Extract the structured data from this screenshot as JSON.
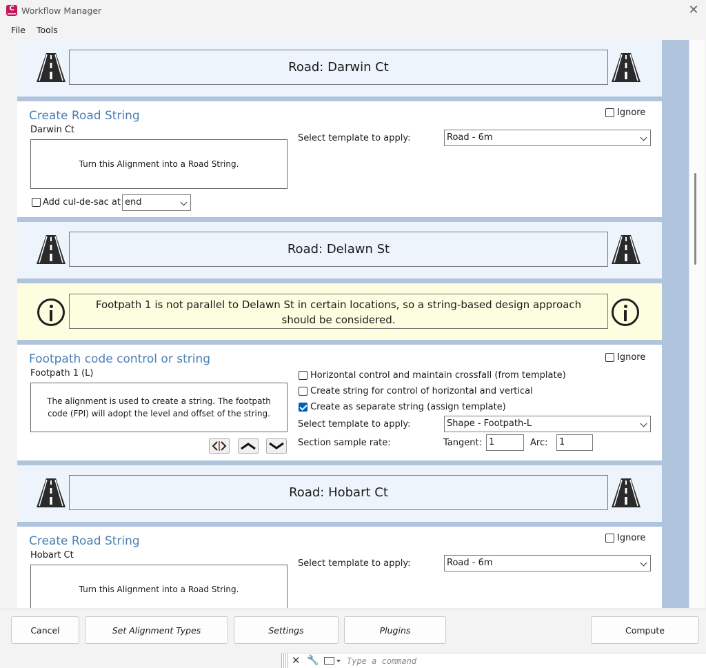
{
  "window": {
    "title": "Workflow Manager",
    "app_icon_letter": "C"
  },
  "menu": {
    "file": "File",
    "tools": "Tools"
  },
  "sections": {
    "road1": {
      "title": "Road: Darwin Ct"
    },
    "create1": {
      "title": "Create Road String",
      "subtitle": "Darwin Ct",
      "ignore_label": "Ignore",
      "ignore_checked": false,
      "description": "Turn this Alignment into a Road String.",
      "template_label": "Select template to apply:",
      "template_value": "Road - 6m",
      "culdesac_label": "Add cul-de-sac at",
      "culdesac_checked": false,
      "culdesac_value": "end"
    },
    "road2": {
      "title": "Road: Delawn St"
    },
    "warning": {
      "text": "Footpath 1 is not parallel to Delawn St in certain locations, so a string-based design approach should be considered."
    },
    "footpath": {
      "title": "Footpath code control or string",
      "subtitle": "Footpath 1 (L)",
      "ignore_label": "Ignore",
      "description": "The alignment is used to create a string. The footpath code (FPI) will adopt the level and offset of the string.",
      "option1": "Horizontal control and maintain crossfall (from template)",
      "option2": "Create string for control of horizontal and vertical",
      "option3": "Create as separate string (assign template)",
      "template_label": "Select template to apply:",
      "template_value": "Shape - Footpath-L",
      "sample_label": "Section sample rate:",
      "tangent_label": "Tangent:",
      "tangent_value": "1",
      "arc_label": "Arc:",
      "arc_value": "1"
    },
    "road3": {
      "title": "Road: Hobart Ct"
    },
    "create2": {
      "title": "Create Road String",
      "subtitle": "Hobart Ct",
      "ignore_label": "Ignore",
      "description": "Turn this Alignment into a Road String.",
      "template_label": "Select template to apply:",
      "template_value": "Road - 6m"
    }
  },
  "buttons": {
    "cancel": "Cancel",
    "set_alignment_types": "Set Alignment Types",
    "settings": "Settings",
    "plugins": "Plugins",
    "compute": "Compute"
  },
  "command_line": {
    "placeholder": "Type a command"
  },
  "colors": {
    "accent_title": "#4a7fb5",
    "panel_gap": "#b0c4de",
    "header_panel": "#edf4fb",
    "warning_panel": "#fdfde0",
    "app_icon": "#c2185b"
  }
}
